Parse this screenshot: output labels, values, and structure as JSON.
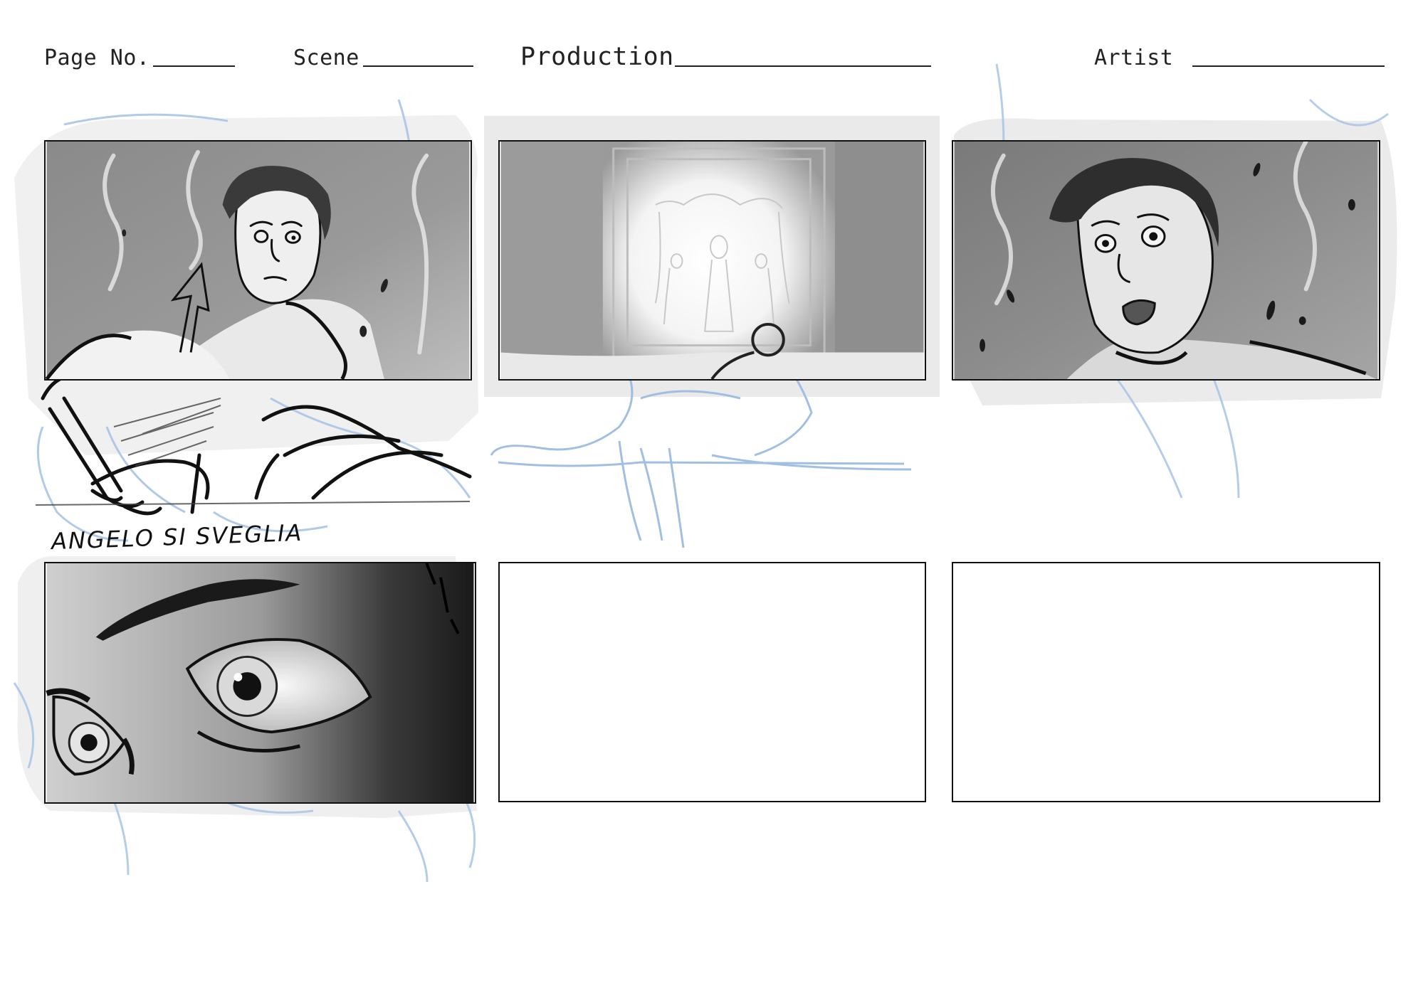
{
  "header": {
    "page_label": "Page No.",
    "scene_label": "Scene",
    "production_label": "Production",
    "artist_label": "Artist"
  },
  "panels": [
    {
      "caption": "ANGELO SI SVEGLIA"
    },
    {
      "caption": ""
    },
    {
      "caption": ""
    },
    {
      "caption": ""
    },
    {
      "caption": ""
    },
    {
      "caption": ""
    }
  ],
  "colors": {
    "sketch_blue": "#a9c4e6",
    "ink": "#111111",
    "panel_border": "#111111"
  }
}
